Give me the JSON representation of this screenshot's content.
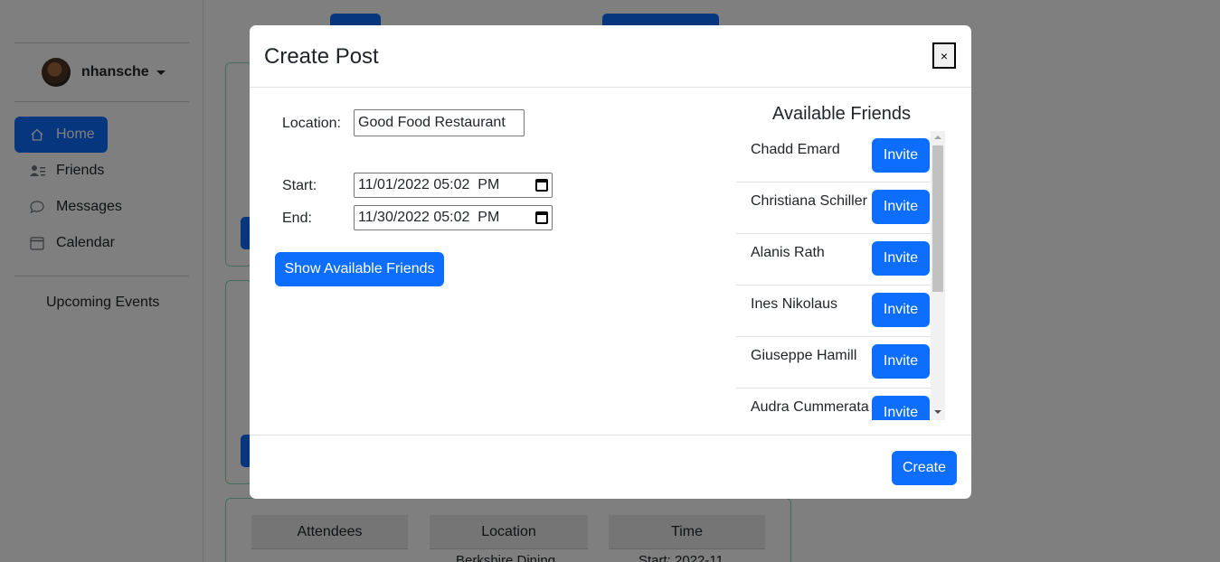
{
  "sidebar": {
    "username": "nhansche",
    "nav": [
      {
        "label": "Home",
        "icon": "home-icon",
        "active": true
      },
      {
        "label": "Friends",
        "icon": "friends-icon",
        "active": false
      },
      {
        "label": "Messages",
        "icon": "chat-icon",
        "active": false
      },
      {
        "label": "Calendar",
        "icon": "calendar-icon",
        "active": false
      }
    ],
    "upcoming_label": "Upcoming Events"
  },
  "events_table": {
    "headers": [
      "Attendees",
      "Location",
      "Time"
    ],
    "partial_cells": [
      "Berkshire Dining",
      "Start: 2022-11"
    ]
  },
  "modal": {
    "title": "Create Post",
    "close_label": "×",
    "location_label": "Location:",
    "location_value": "Good Food Restaurant",
    "start_label": "Start:",
    "start_value": "11/01/2022 05:02  PM",
    "end_label": "End:",
    "end_value": "11/30/2022 05:02  PM",
    "show_friends_label": "Show Available Friends",
    "friends_title": "Available Friends",
    "invite_label": "Invite",
    "friends": [
      "Chadd Emard",
      "Christiana Schiller",
      "Alanis Rath",
      "Ines Nikolaus",
      "Giuseppe Hamill",
      "Audra Cummerata"
    ],
    "create_label": "Create"
  },
  "colors": {
    "primary": "#0d6efd",
    "card_border": "#8fd9b6",
    "backdrop": "rgba(0,0,0,0.5)"
  }
}
